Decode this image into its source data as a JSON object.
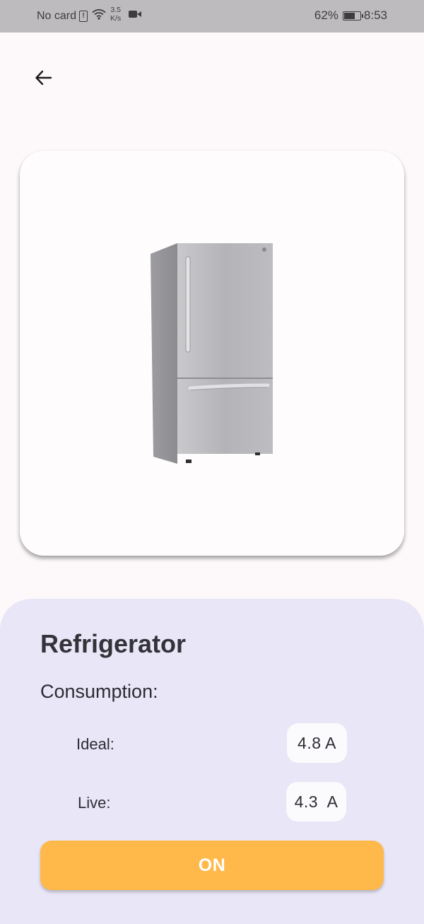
{
  "status_bar": {
    "carrier": "No card",
    "sim_alert": "!",
    "speed_value": "3.5",
    "speed_unit": "K/s",
    "battery_percent": "62%",
    "battery_level": 0.62,
    "time": "8:53"
  },
  "icons": {
    "back": "arrow-left-icon",
    "wifi": "wifi-icon",
    "video": "video-camera-icon",
    "battery": "battery-charging-icon",
    "sim": "sim-alert-icon"
  },
  "device": {
    "name": "Refrigerator",
    "image": "refrigerator-photo",
    "consumption_label": "Consumption:",
    "readings": [
      {
        "label": "Ideal:",
        "value": "4.8 A"
      },
      {
        "label": "Live:",
        "value": "4.3  A"
      }
    ],
    "power_button_label": "ON"
  },
  "colors": {
    "status_bar_bg": "#bdbbbd",
    "page_bg": "#fdf9fa",
    "panel_bg": "#e9e6f7",
    "button_bg": "#ffb84a",
    "button_text": "#ffffff"
  }
}
